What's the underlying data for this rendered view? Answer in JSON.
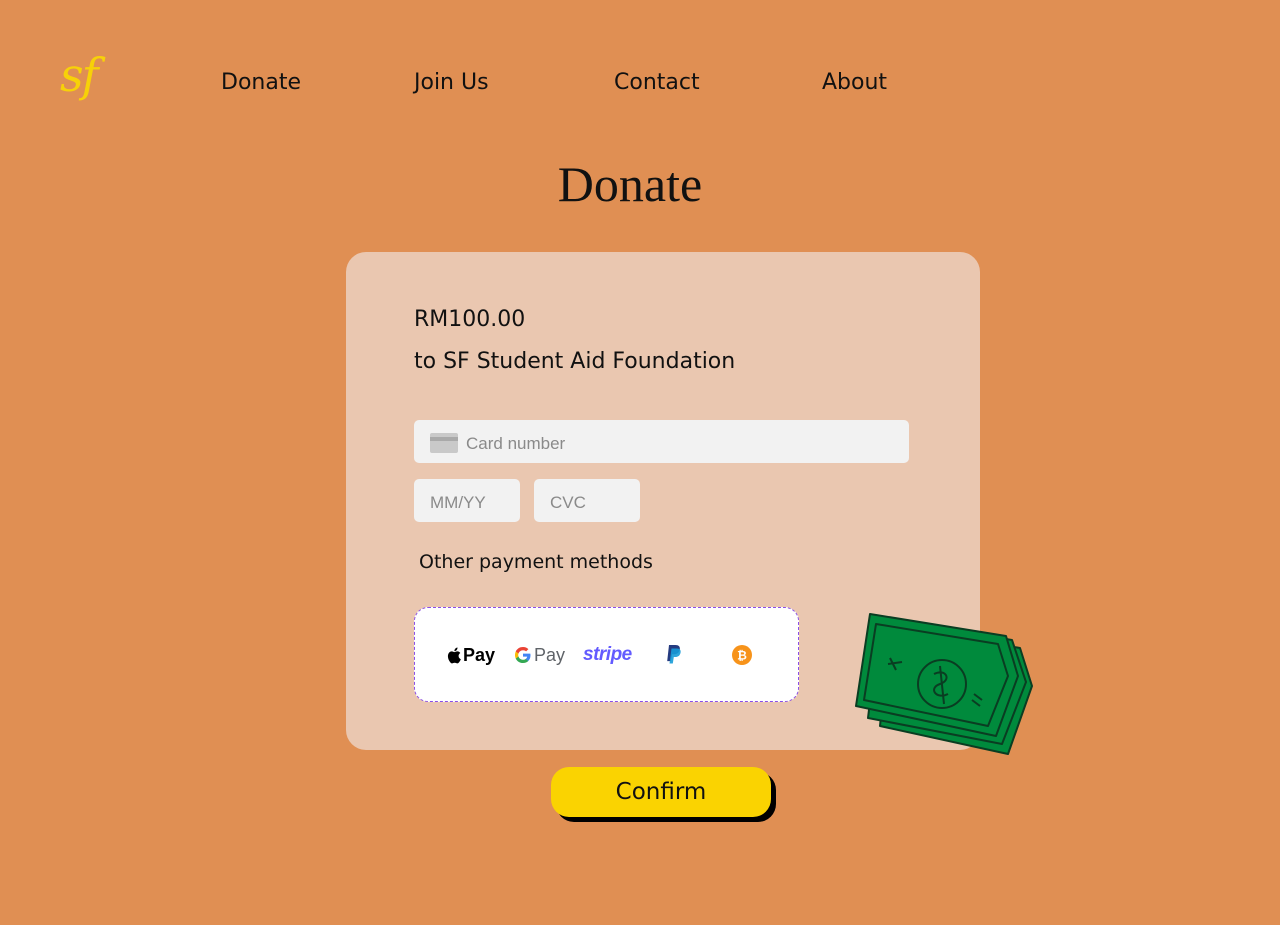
{
  "brand": {
    "logo_text": "sf",
    "logo_color": "#F7D108"
  },
  "nav": {
    "items": [
      {
        "label": "Donate"
      },
      {
        "label": "Join Us"
      },
      {
        "label": "Contact"
      },
      {
        "label": "About"
      }
    ]
  },
  "page": {
    "title": "Donate",
    "background": "#E08F53"
  },
  "donation": {
    "amount": "RM100.00",
    "recipient": "to SF Student Aid Foundation"
  },
  "form": {
    "card_number": {
      "placeholder": "Card number",
      "icon": "credit-card-icon",
      "value": ""
    },
    "expiry": {
      "placeholder": "MM/YY",
      "value": ""
    },
    "cvc": {
      "placeholder": "CVC",
      "value": ""
    }
  },
  "other_methods": {
    "label": "Other payment methods",
    "methods": [
      {
        "name": "Apple Pay",
        "text": "Pay",
        "icon": "apple-icon"
      },
      {
        "name": "Google Pay",
        "text": "Pay",
        "icon": "google-g-icon"
      },
      {
        "name": "Stripe",
        "text": "stripe",
        "icon": "stripe-logo"
      },
      {
        "name": "PayPal",
        "icon": "paypal-icon"
      },
      {
        "name": "Bitcoin",
        "icon": "bitcoin-icon"
      }
    ]
  },
  "decoration": {
    "illustration": "money-bills-illustration",
    "color": "#008A3C"
  },
  "confirm": {
    "label": "Confirm",
    "color": "#FAD301"
  }
}
